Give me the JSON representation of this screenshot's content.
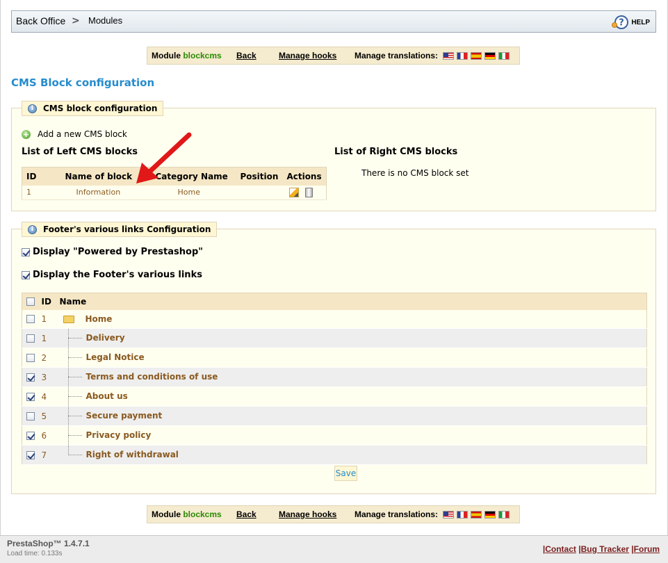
{
  "breadcrumb": {
    "back_office": "Back Office",
    "separator": ">",
    "modules": "Modules"
  },
  "help": {
    "label": "HELP",
    "icon": "help-icon"
  },
  "module_bar": {
    "module_label": "Module",
    "module_name": "blockcms",
    "back": "Back",
    "manage_hooks": "Manage hooks",
    "manage_translations": "Manage translations:",
    "flags": [
      "flag-en-icon",
      "flag-fr-icon",
      "flag-es-icon",
      "flag-de-icon",
      "flag-it-icon"
    ]
  },
  "page_title": "CMS Block configuration",
  "cms_config": {
    "legend": "CMS block configuration",
    "add_new": "Add a new CMS block",
    "left_title": "List of Left CMS blocks",
    "right_title": "List of Right CMS blocks",
    "no_block": "There is no CMS block set",
    "columns": [
      "ID",
      "Name of block",
      "Category Name",
      "Position",
      "Actions"
    ],
    "rows": [
      {
        "id": "1",
        "name": "Information",
        "category": "Home",
        "position": ""
      }
    ]
  },
  "footer_config": {
    "legend": "Footer's various links Configuration",
    "opt_powered": "Display \"Powered by Prestashop\"",
    "opt_links": "Display the Footer's various links",
    "columns": [
      "ID",
      "Name"
    ],
    "rows": [
      {
        "id": "1",
        "name": "Home",
        "checked": false
      },
      {
        "id": "1",
        "name": "Delivery",
        "checked": false
      },
      {
        "id": "2",
        "name": "Legal Notice",
        "checked": false
      },
      {
        "id": "3",
        "name": "Terms and conditions of use",
        "checked": true
      },
      {
        "id": "4",
        "name": "About us",
        "checked": true
      },
      {
        "id": "5",
        "name": "Secure payment",
        "checked": false
      },
      {
        "id": "6",
        "name": "Privacy policy",
        "checked": true
      },
      {
        "id": "7",
        "name": "Right of withdrawal",
        "checked": true
      }
    ],
    "save": "Save"
  },
  "footer": {
    "version": "PrestaShop™ 1.4.7.1",
    "load_time": "Load time: 0.133s",
    "sep": "|",
    "contact": "Contact",
    "bug_tracker": "Bug Tracker",
    "forum": "Forum"
  },
  "colors": {
    "title_blue": "#268ccd",
    "module_green": "#2b8a05",
    "link_brown": "#8a5a20",
    "panel_bg": "#fffff0",
    "header_bg": "#f5e7c5",
    "arrow_red": "#e01818"
  }
}
